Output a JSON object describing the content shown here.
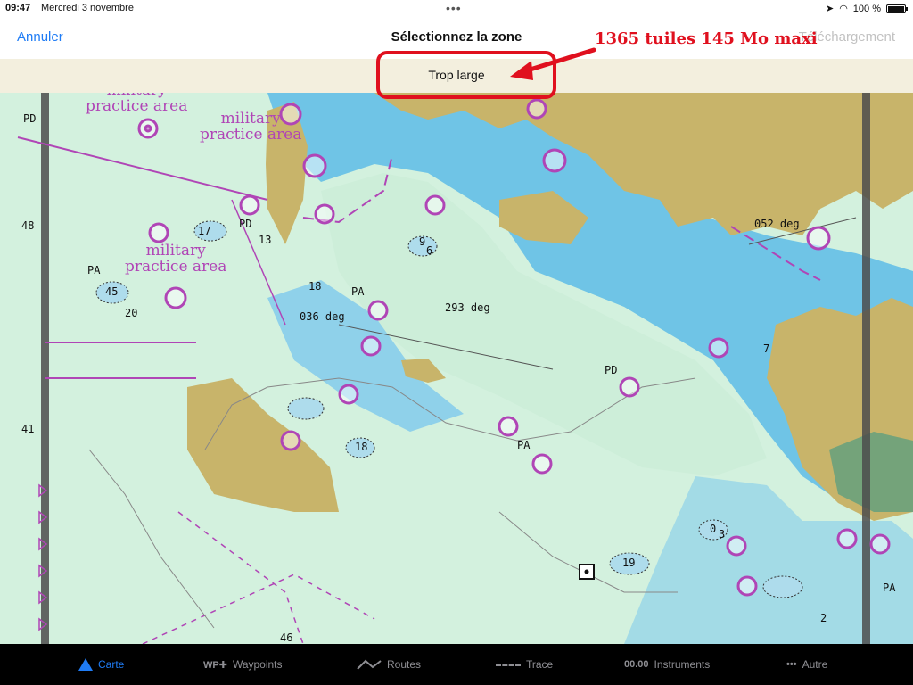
{
  "status_bar": {
    "time": "09:47",
    "date": "Mercredi 3 novembre",
    "battery": "100 %",
    "battery_level": 1.0
  },
  "nav": {
    "cancel_label": "Annuler",
    "title": "Sélectionnez la zone",
    "download_label": "Téléchargement"
  },
  "annotation": {
    "text": "1365 tuiles 145 Mo maxi"
  },
  "warning": {
    "text": "Trop large"
  },
  "map": {
    "zones": [
      {
        "line1": "military",
        "line2": "practice area"
      },
      {
        "line1": "military",
        "line2": "practice area"
      },
      {
        "line1": "military",
        "line2": "practice area"
      }
    ],
    "bearings": [
      "293 deg",
      "052 deg",
      "036 deg"
    ],
    "soundings": [
      "48",
      "17",
      "13",
      "45",
      "20",
      "41",
      "18",
      "6",
      "9",
      "46",
      "19",
      "18",
      "7",
      "0",
      "2",
      "3"
    ],
    "marks": [
      "PD",
      "PA"
    ]
  },
  "tabs": [
    {
      "label": "Carte",
      "icon": "chart-icon",
      "glyph": "",
      "active": true
    },
    {
      "label": "Waypoints",
      "icon": "waypoint-icon",
      "glyph": "WP✚",
      "active": false
    },
    {
      "label": "Routes",
      "icon": "route-icon",
      "glyph": "⁄⁄",
      "active": false
    },
    {
      "label": "Trace",
      "icon": "track-icon",
      "glyph": "",
      "active": false
    },
    {
      "label": "Instruments",
      "icon": "instruments-icon",
      "glyph": "00.00",
      "active": false
    },
    {
      "label": "Autre",
      "icon": "more-icon",
      "glyph": "•••",
      "active": false
    }
  ],
  "colors": {
    "accent": "#1f7cf5",
    "annotation": "#e0101e",
    "land": "#c8b46a",
    "shallow": "#6fc4e6",
    "water": "#cdeed9",
    "zone": "#b045b6"
  }
}
